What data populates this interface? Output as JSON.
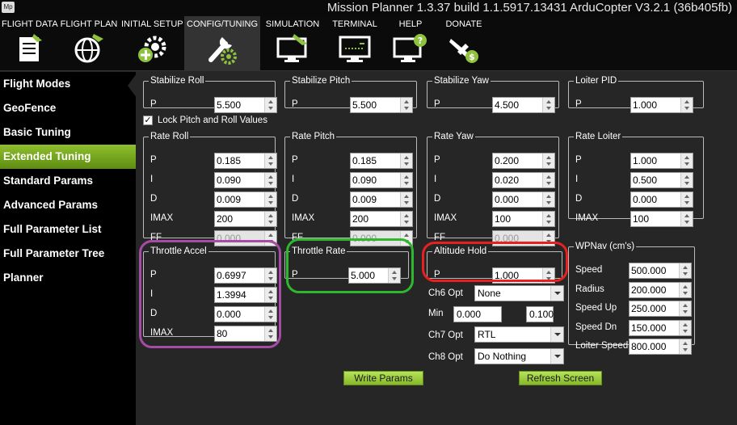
{
  "window": {
    "logo_text": "Mp",
    "title": "Mission Planner 1.3.37 build 1.1.5917.13431 ArduCopter V3.2.1 (36b405fb)"
  },
  "menu": [
    {
      "label": "FLIGHT DATA",
      "icon": "flight-data-icon"
    },
    {
      "label": "FLIGHT PLAN",
      "icon": "flight-plan-icon"
    },
    {
      "label": "INITIAL SETUP",
      "icon": "initial-setup-icon"
    },
    {
      "label": "CONFIG/TUNING",
      "icon": "config-tuning-icon"
    },
    {
      "label": "SIMULATION",
      "icon": "simulation-icon"
    },
    {
      "label": "TERMINAL",
      "icon": "terminal-icon"
    },
    {
      "label": "HELP",
      "icon": "help-icon"
    },
    {
      "label": "DONATE",
      "icon": "donate-icon"
    }
  ],
  "sidebar": {
    "items": [
      "Flight Modes",
      "GeoFence",
      "Basic Tuning",
      "Extended Tuning",
      "Standard Params",
      "Advanced Params",
      "Full Parameter List",
      "Full Parameter Tree",
      "Planner"
    ],
    "active_index": 3
  },
  "lock_pitch_roll": {
    "label": "Lock Pitch and Roll Values",
    "checked": true,
    "mark": "✓"
  },
  "groups": {
    "stabilize_roll": {
      "title": "Stabilize Roll",
      "rows": [
        {
          "label": "P",
          "value": "5.500"
        }
      ]
    },
    "stabilize_pitch": {
      "title": "Stabilize Pitch",
      "rows": [
        {
          "label": "P",
          "value": "5.500"
        }
      ]
    },
    "stabilize_yaw": {
      "title": "Stabilize Yaw",
      "rows": [
        {
          "label": "P",
          "value": "4.500"
        }
      ]
    },
    "loiter_pid": {
      "title": "Loiter PID",
      "rows": [
        {
          "label": "P",
          "value": "1.000"
        }
      ]
    },
    "rate_roll": {
      "title": "Rate Roll",
      "rows": [
        {
          "label": "P",
          "value": "0.185"
        },
        {
          "label": "I",
          "value": "0.090"
        },
        {
          "label": "D",
          "value": "0.009"
        },
        {
          "label": "IMAX",
          "value": "200"
        },
        {
          "label": "FF",
          "value": "0.000"
        }
      ]
    },
    "rate_pitch": {
      "title": "Rate Pitch",
      "rows": [
        {
          "label": "P",
          "value": "0.185"
        },
        {
          "label": "I",
          "value": "0.090"
        },
        {
          "label": "D",
          "value": "0.009"
        },
        {
          "label": "IMAX",
          "value": "200"
        },
        {
          "label": "FF",
          "value": "0.000"
        }
      ]
    },
    "rate_yaw": {
      "title": "Rate Yaw",
      "rows": [
        {
          "label": "P",
          "value": "0.200"
        },
        {
          "label": "I",
          "value": "0.020"
        },
        {
          "label": "D",
          "value": "0.000"
        },
        {
          "label": "IMAX",
          "value": "100"
        },
        {
          "label": "FF",
          "value": "0.000"
        }
      ]
    },
    "rate_loiter": {
      "title": "Rate Loiter",
      "rows": [
        {
          "label": "P",
          "value": "1.000"
        },
        {
          "label": "I",
          "value": "0.500"
        },
        {
          "label": "D",
          "value": "0.000"
        },
        {
          "label": "IMAX",
          "value": "100"
        }
      ]
    },
    "throttle_accel": {
      "title": "Throttle Accel",
      "rows": [
        {
          "label": "P",
          "value": "0.6997"
        },
        {
          "label": "I",
          "value": "1.3994"
        },
        {
          "label": "D",
          "value": "0.000"
        },
        {
          "label": "IMAX",
          "value": "80"
        }
      ]
    },
    "throttle_rate": {
      "title": "Throttle Rate",
      "rows": [
        {
          "label": "P",
          "value": "5.000"
        }
      ]
    },
    "altitude_hold": {
      "title": "Altitude Hold",
      "rows": [
        {
          "label": "P",
          "value": "1.000"
        }
      ]
    },
    "wpnav": {
      "title": "WPNav (cm's)",
      "rows": [
        {
          "label": "Speed",
          "value": "500.000"
        },
        {
          "label": "Radius",
          "value": "200.000"
        },
        {
          "label": "Speed Up",
          "value": "250.000"
        },
        {
          "label": "Speed Dn",
          "value": "150.000"
        },
        {
          "label": "Loiter Speed",
          "value": "800.000"
        }
      ]
    }
  },
  "channels": {
    "ch6_label": "Ch6 Opt",
    "ch6_value": "None",
    "min_label": "Min",
    "min_value": "0.000",
    "max_value": "0.100",
    "ch7_label": "Ch7 Opt",
    "ch7_value": "RTL",
    "ch8_label": "Ch8 Opt",
    "ch8_value": "Do Nothing"
  },
  "buttons": {
    "write_params": "Write Params",
    "refresh_screen": "Refresh Screen"
  },
  "highlight_colors": {
    "throttle_accel": "#a64ca6",
    "throttle_rate": "#2eb82e",
    "altitude_hold": "#e82020"
  }
}
